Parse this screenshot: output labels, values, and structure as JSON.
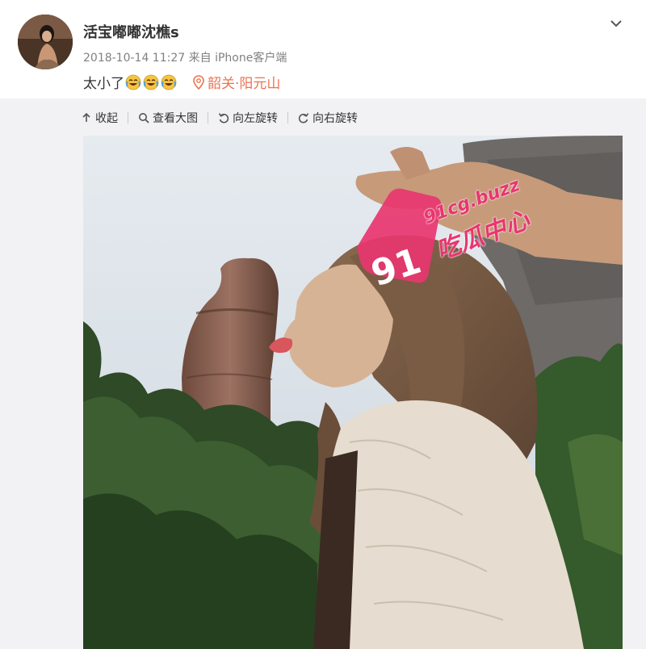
{
  "post": {
    "username": "活宝嘟嘟沈樵s",
    "timestamp": "2018-10-14 11:27",
    "source": "来自 iPhone客户端",
    "text": "太小了",
    "emoji_icons": [
      "laughing-crying-emoji",
      "laughing-crying-emoji",
      "laughing-crying-emoji"
    ],
    "location": "韶关·阳元山",
    "more_icon": "chevron-down-icon"
  },
  "toolbar": {
    "collapse_label": "收起",
    "view_large_label": "查看大图",
    "rotate_left_label": "向左旋转",
    "rotate_right_label": "向右旋转"
  },
  "watermark": {
    "number": "91",
    "domain": "91cg.buzz",
    "name": "吃瓜中心"
  },
  "colors": {
    "location": "#eb7350",
    "watermark": "#e8366f",
    "panel_bg": "#f2f2f5"
  }
}
